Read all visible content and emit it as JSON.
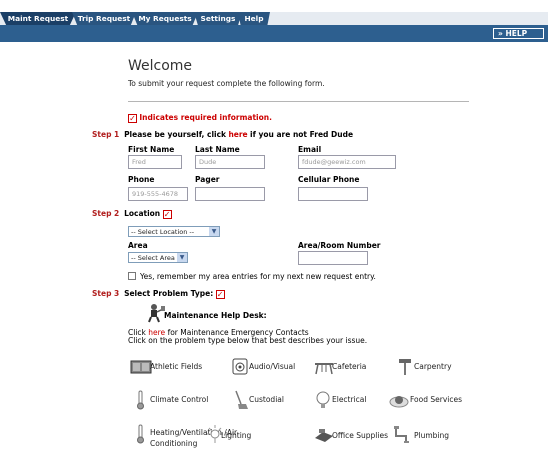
{
  "tabs": [
    "Maint Request",
    "Trip Request",
    "My Requests",
    "Settings",
    "Help"
  ],
  "help_button": "» HELP",
  "welcome": {
    "title": "Welcome",
    "intro": "To submit your request complete the following form."
  },
  "required_note": "Indicates required information.",
  "step1": {
    "label": "Step 1",
    "text_before": "Please be yourself, click",
    "link": "here",
    "text_after": "if you are not Fred Dude",
    "first_name_label": "First Name",
    "first_name_value": "Fred",
    "last_name_label": "Last Name",
    "last_name_value": "Dude",
    "email_label": "Email",
    "email_value": "fdude@geewiz.com",
    "phone_label": "Phone",
    "phone_value": "919-555-4678",
    "pager_label": "Pager",
    "pager_value": "",
    "cell_label": "Cellular Phone",
    "cell_value": ""
  },
  "step2": {
    "label": "Step 2",
    "location_label": "Location",
    "location_select": "-- Select Location --",
    "area_label": "Area",
    "area_select": "-- Select Area --",
    "room_label": "Area/Room Number",
    "room_value": "",
    "remember_text": "Yes, remember my area entries for my next new request entry."
  },
  "step3": {
    "label": "Step 3",
    "title": "Select Problem Type:",
    "helpdesk_title": "Maintenance Help Desk:",
    "emergency_pre": "Click",
    "emergency_link": "here",
    "emergency_post": "for Maintenance Emergency Contacts",
    "instruction": "Click on the problem type below that best describes your issue.",
    "categories": [
      {
        "label": "Athletic Fields",
        "icon": "athletic-fields-icon"
      },
      {
        "label": "Audio/Visual",
        "icon": "audio-visual-icon"
      },
      {
        "label": "Cafeteria",
        "icon": "cafeteria-icon"
      },
      {
        "label": "Carpentry",
        "icon": "carpentry-icon"
      },
      {
        "label": "Climate Control",
        "icon": "climate-control-icon"
      },
      {
        "label": "Custodial",
        "icon": "custodial-icon"
      },
      {
        "label": "Electrical",
        "icon": "electrical-icon"
      },
      {
        "label": "Food Services",
        "icon": "food-services-icon"
      },
      {
        "label": "Heating/Ventilation /Air",
        "label2": "Conditioning",
        "icon": "hvac-icon"
      },
      {
        "label": "Lighting",
        "icon": "lighting-icon"
      },
      {
        "label": "Office Supplies",
        "icon": "office-supplies-icon"
      },
      {
        "label": "Plumbing",
        "icon": "plumbing-icon"
      }
    ]
  },
  "colors": {
    "tab_bg": "#2a5580",
    "band": "#2d5f8f",
    "step": "#b01c1c",
    "required": "#cc0000"
  }
}
